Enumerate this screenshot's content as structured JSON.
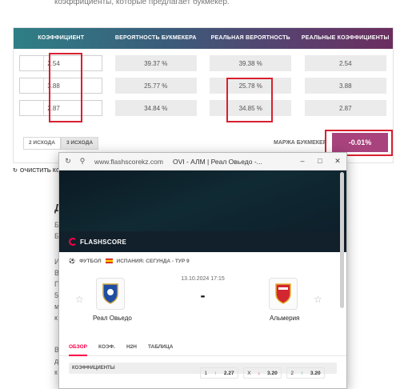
{
  "page": {
    "intro_text": "коэффициенты, которые предлагает букмекер.",
    "heading": "Д",
    "bg_letters": [
      "Б",
      "Б",
      "И",
      "В",
      "П",
      "5",
      "м",
      "к",
      "В",
      "д",
      "к"
    ]
  },
  "calculator": {
    "headers": [
      "КОЭФФИЦИЕНТ",
      "ВЕРОЯТНОСТЬ БУКМЕКЕРА",
      "РЕАЛЬНАЯ ВЕРОЯТНОСТЬ",
      "РЕАЛЬНЫЕ КОЭФФИЦИЕНТЫ"
    ],
    "rows": [
      {
        "coef": "2.54",
        "bookmaker_prob": "39.37 %",
        "real_prob": "39.38 %",
        "real_coef": "2.54"
      },
      {
        "coef": "3.88",
        "bookmaker_prob": "25.77 %",
        "real_prob": "25.78 %",
        "real_coef": "3.88"
      },
      {
        "coef": "2.87",
        "bookmaker_prob": "34.84 %",
        "real_prob": "34.85 %",
        "real_coef": "2.87"
      }
    ],
    "tabs": [
      "2 ИСХОДА",
      "3 ИСХОДА"
    ],
    "margin_label": "МАРЖА БУКМЕКЕР",
    "margin_value": "-0.01%",
    "clear_label": "ОЧИСТИТЬ КОЭ"
  },
  "popup": {
    "url": "www.flashscorekz.com",
    "title": "OVI - АЛМ | Реал Овьедо -...",
    "brand": "FLASHSCORE",
    "sport": "ФУТБОЛ",
    "league": "ИСПАНИЯ: СЕГУНДА - ТУР 9",
    "date": "13.10.2024 17:15",
    "score": "-",
    "home_team": "Реал Овьедо",
    "away_team": "Альмерия",
    "tabs": [
      "ОБЗОР",
      "КОЭФ.",
      "H2H",
      "ТАБЛИЦА"
    ],
    "odds_header": "КОЭФФИЦИЕНТЫ",
    "odds": [
      {
        "label": "1",
        "value": "2.27",
        "trend": "up"
      },
      {
        "label": "X",
        "value": "3.20",
        "trend": "down"
      },
      {
        "label": "2",
        "value": "3.20",
        "trend": "up"
      }
    ]
  },
  "colors": {
    "margin_bg": "#a8437d",
    "highlight": "#d82030",
    "flashscore_accent": "#ff0046"
  }
}
